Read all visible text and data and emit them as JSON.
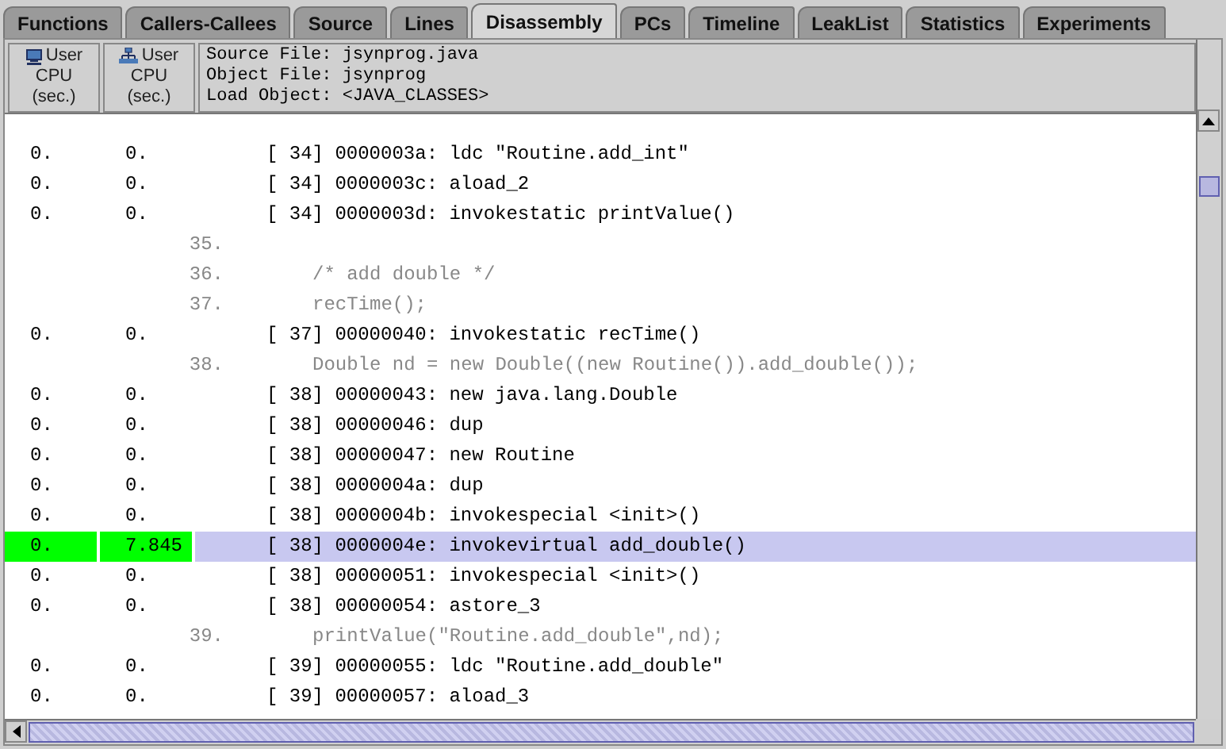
{
  "tabs": [
    {
      "label": "Functions",
      "selected": false
    },
    {
      "label": "Callers-Callees",
      "selected": false
    },
    {
      "label": "Source",
      "selected": false
    },
    {
      "label": "Lines",
      "selected": false
    },
    {
      "label": "Disassembly",
      "selected": true
    },
    {
      "label": "PCs",
      "selected": false
    },
    {
      "label": "Timeline",
      "selected": false
    },
    {
      "label": "LeakList",
      "selected": false
    },
    {
      "label": "Statistics",
      "selected": false
    },
    {
      "label": "Experiments",
      "selected": false
    }
  ],
  "columns": [
    {
      "kind": "exclusive",
      "lines": [
        "User",
        "CPU",
        "(sec.)"
      ]
    },
    {
      "kind": "inclusive",
      "lines": [
        "User",
        "CPU",
        "(sec.)"
      ]
    }
  ],
  "info": [
    "Source File: jsynprog.java",
    "Object File: jsynprog",
    "Load Object: <JAVA_CLASSES>"
  ],
  "rows": [
    {
      "kind": "instr",
      "selected": false,
      "values": [
        "0.",
        "0."
      ],
      "text": "[ 34] 0000003a: ldc \"Routine.add_int\""
    },
    {
      "kind": "instr",
      "selected": false,
      "values": [
        "0.",
        "0."
      ],
      "text": "[ 34] 0000003c: aload_2"
    },
    {
      "kind": "instr",
      "selected": false,
      "values": [
        "0.",
        "0."
      ],
      "text": "[ 34] 0000003d: invokestatic printValue()"
    },
    {
      "kind": "source",
      "selected": false,
      "line": "35.",
      "text": ""
    },
    {
      "kind": "source",
      "selected": false,
      "line": "36.",
      "text": "/* add double */"
    },
    {
      "kind": "source",
      "selected": false,
      "line": "37.",
      "text": "recTime();"
    },
    {
      "kind": "instr",
      "selected": false,
      "values": [
        "0.",
        "0."
      ],
      "text": "[ 37] 00000040: invokestatic recTime()"
    },
    {
      "kind": "source",
      "selected": false,
      "line": "38.",
      "text": "Double nd = new Double((new Routine()).add_double());"
    },
    {
      "kind": "instr",
      "selected": false,
      "values": [
        "0.",
        "0."
      ],
      "text": "[ 38] 00000043: new java.lang.Double"
    },
    {
      "kind": "instr",
      "selected": false,
      "values": [
        "0.",
        "0."
      ],
      "text": "[ 38] 00000046: dup"
    },
    {
      "kind": "instr",
      "selected": false,
      "values": [
        "0.",
        "0."
      ],
      "text": "[ 38] 00000047: new Routine"
    },
    {
      "kind": "instr",
      "selected": false,
      "values": [
        "0.",
        "0."
      ],
      "text": "[ 38] 0000004a: dup"
    },
    {
      "kind": "instr",
      "selected": false,
      "values": [
        "0.",
        "0."
      ],
      "text": "[ 38] 0000004b: invokespecial <init>()"
    },
    {
      "kind": "instr",
      "selected": true,
      "values": [
        "0.",
        "7.845"
      ],
      "text": "[ 38] 0000004e: invokevirtual add_double()"
    },
    {
      "kind": "instr",
      "selected": false,
      "values": [
        "0.",
        "0."
      ],
      "text": "[ 38] 00000051: invokespecial <init>()"
    },
    {
      "kind": "instr",
      "selected": false,
      "values": [
        "0.",
        "0."
      ],
      "text": "[ 38] 00000054: astore_3"
    },
    {
      "kind": "source",
      "selected": false,
      "line": "39.",
      "text": "printValue(\"Routine.add_double\",nd);"
    },
    {
      "kind": "instr",
      "selected": false,
      "values": [
        "0.",
        "0."
      ],
      "text": "[ 39] 00000055: ldc \"Routine.add_double\""
    },
    {
      "kind": "instr",
      "selected": false,
      "values": [
        "0.",
        "0."
      ],
      "text": "[ 39] 00000057: aload_3"
    }
  ]
}
